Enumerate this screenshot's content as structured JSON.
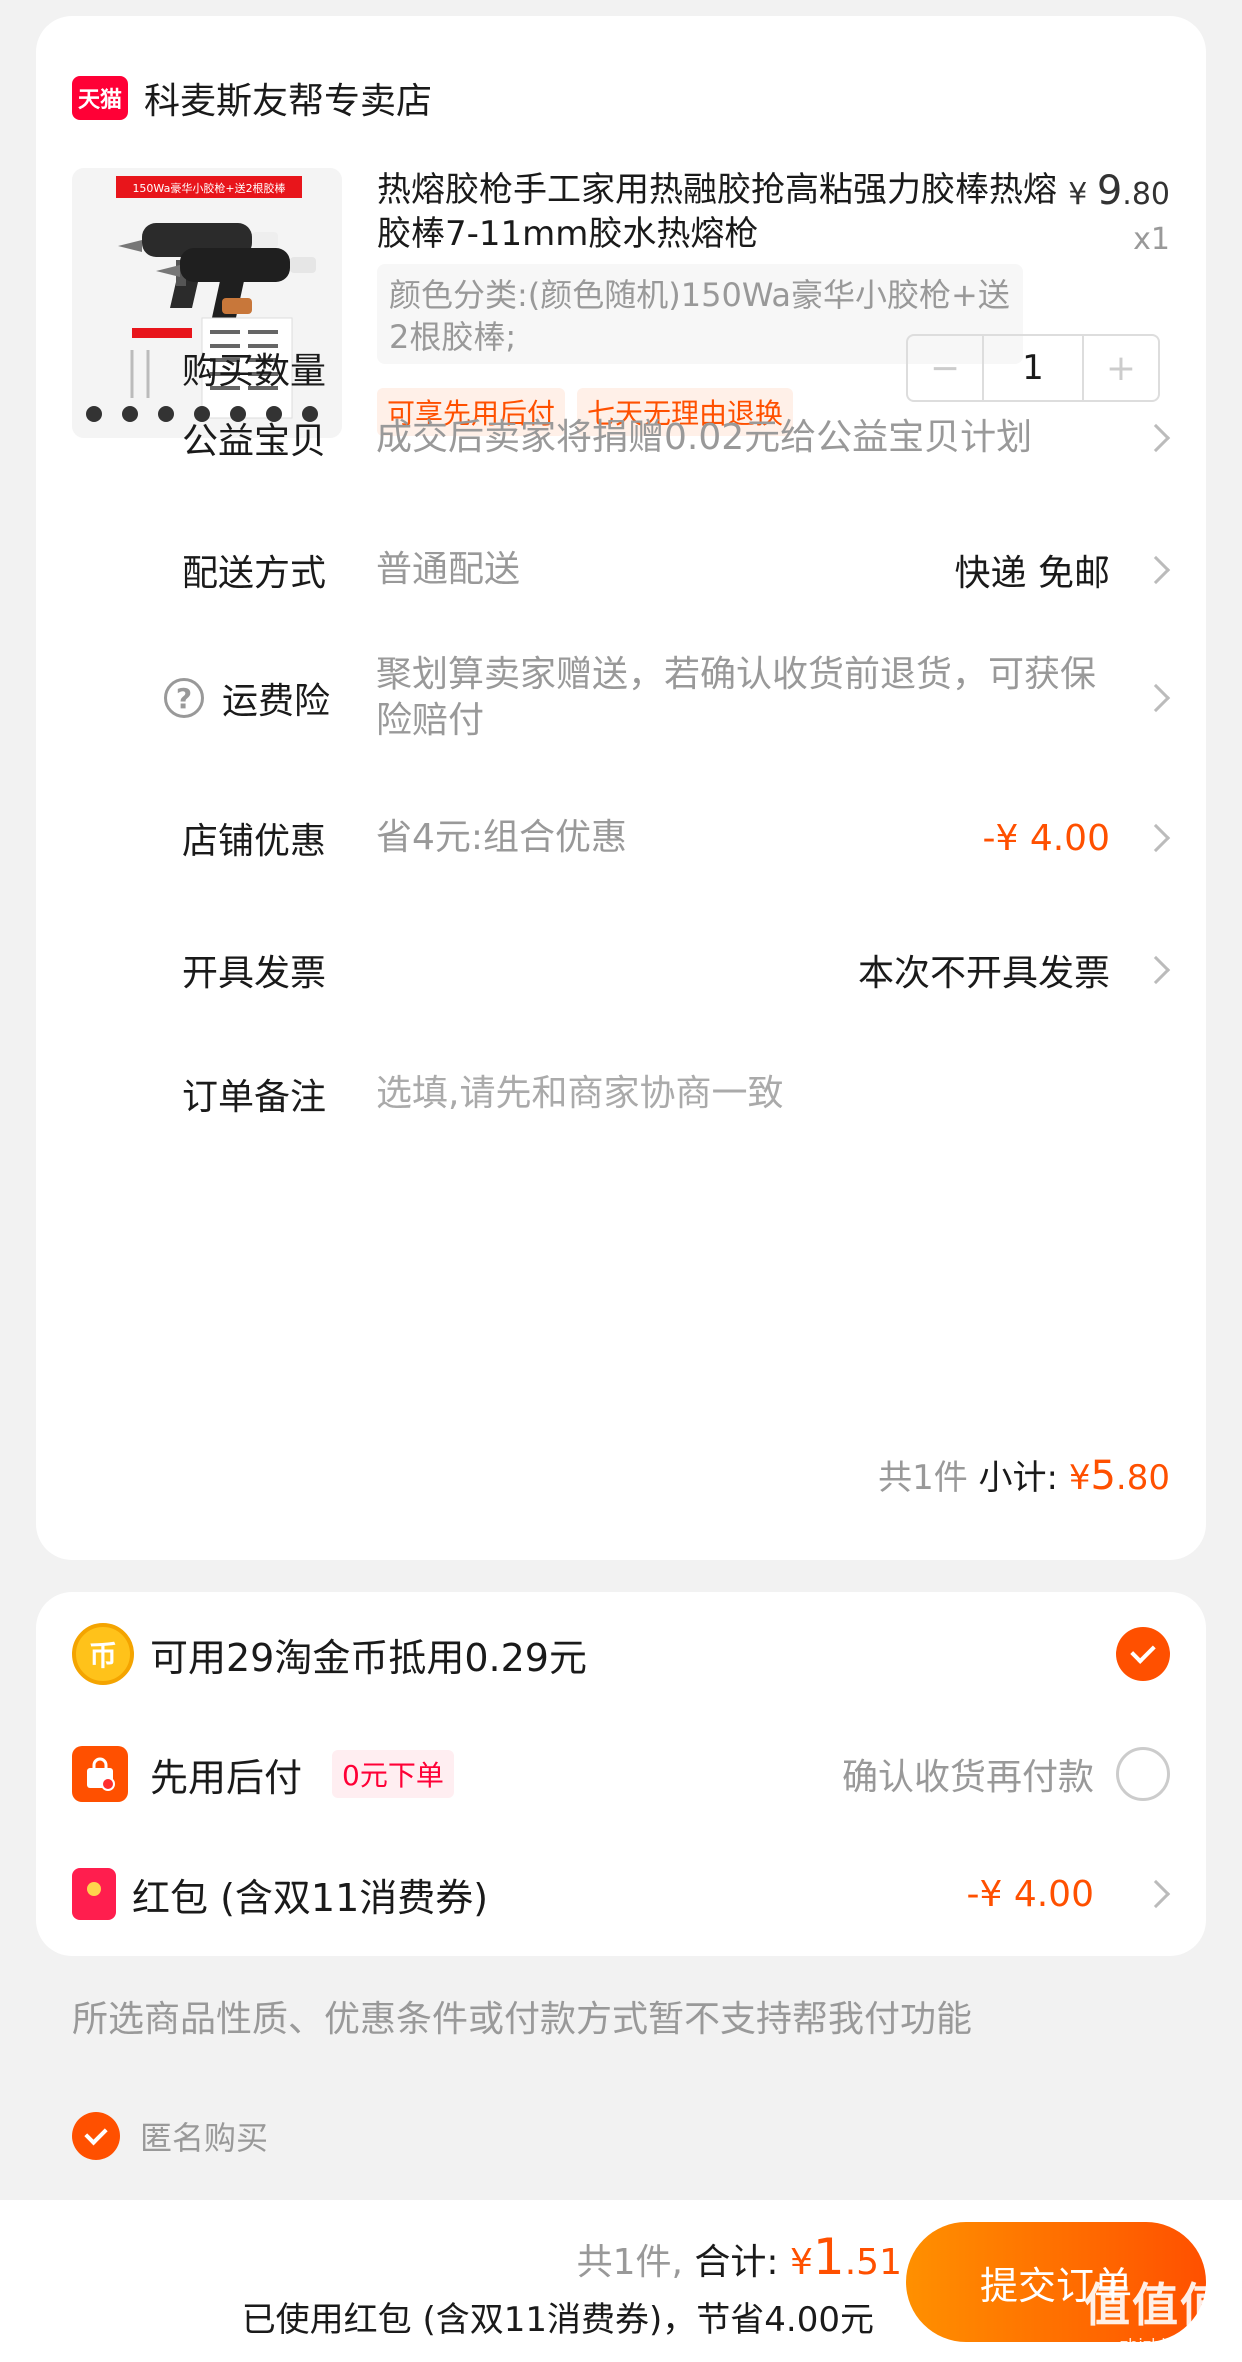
{
  "shop": {
    "logo_text": "天猫",
    "name": "科麦斯友帮专卖店"
  },
  "product": {
    "image_banner": "150Wa豪华小胶枪+送2根胶棒",
    "title": "热熔胶枪手工家用热融胶抢高粘强力胶棒热熔胶棒7-11mm胶水热熔枪",
    "price_symbol": "¥",
    "price_int": "9",
    "price_dec": ".80",
    "quantity_mark": "x1",
    "sku": "颜色分类:(颜色随机)150Wa豪华小胶枪+送2根胶棒;",
    "tags": [
      "可享先用后付",
      "七天无理由退换"
    ]
  },
  "rows": {
    "quantity": {
      "label": "购买数量",
      "minus": "−",
      "value": "1",
      "plus": "+"
    },
    "charity": {
      "label": "公益宝贝",
      "desc": "成交后卖家将捐赠0.02元给公益宝贝计划"
    },
    "delivery": {
      "label": "配送方式",
      "desc": "普通配送",
      "value": "快递 免邮"
    },
    "insurance": {
      "icon": "?",
      "label": "运费险",
      "desc": "聚划算卖家赠送，若确认收货前退货，可获保险赔付"
    },
    "discount": {
      "label": "店铺优惠",
      "desc": "省4元:组合优惠",
      "value": "-¥ 4.00"
    },
    "invoice": {
      "label": "开具发票",
      "value": "本次不开具发票"
    },
    "note": {
      "label": "订单备注",
      "placeholder": "选填,请先和商家协商一致"
    }
  },
  "subtotal": {
    "count": "共1件",
    "label": "小计:",
    "symbol": "¥",
    "int": "5",
    "dec": ".80"
  },
  "payment": {
    "coins": {
      "icon": "币",
      "label": "可用29淘金币抵用0.29元",
      "checked": true
    },
    "pay_later": {
      "label": "先用后付",
      "badge": "0元下单",
      "desc": "确认收货再付款",
      "checked": false
    },
    "red_packet": {
      "label": "红包 (含双11消费券)",
      "value": "-¥ 4.00"
    }
  },
  "notice": "所选商品性质、优惠条件或付款方式暂不支持帮我付功能",
  "anonymous": {
    "label": "匿名购买",
    "checked": true
  },
  "bottom": {
    "count": "共1件,",
    "total_label": "合计:",
    "symbol": "¥",
    "int": "1",
    "dec": ".51",
    "saving": "已使用红包 (含双11消费券)，节省4.00元",
    "submit": "提交订单"
  },
  "watermark": {
    "big": "值值值",
    "small": "zhizhizhi.com"
  },
  "colors": {
    "accent": "#ff5000",
    "tmall": "#ff0036",
    "bg": "#f2f2f2"
  }
}
